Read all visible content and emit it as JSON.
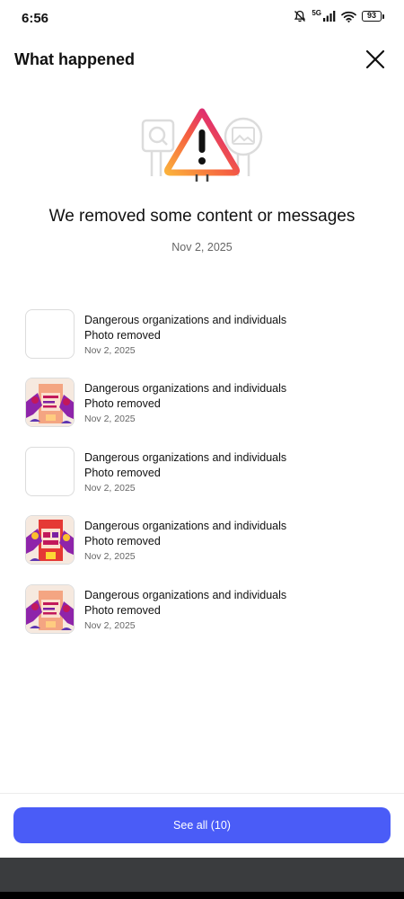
{
  "status_bar": {
    "time": "6:56",
    "network": "5G",
    "battery": "93",
    "icons": [
      "bell-muted-icon",
      "signal-icon",
      "wifi-icon",
      "battery-icon"
    ]
  },
  "header": {
    "title": "What happened",
    "close_icon": "close-icon"
  },
  "hero": {
    "icon": "warning-icon",
    "title": "We removed some content or messages",
    "date": "Nov 2, 2025"
  },
  "items": [
    {
      "reason": "Dangerous organizations and individuals",
      "status": "Photo removed",
      "date": "Nov 2, 2025",
      "thumb": "blank"
    },
    {
      "reason": "Dangerous organizations and individuals",
      "status": "Photo removed",
      "date": "Nov 2, 2025",
      "thumb": "illustration"
    },
    {
      "reason": "Dangerous organizations and individuals",
      "status": "Photo removed",
      "date": "Nov 2, 2025",
      "thumb": "blank"
    },
    {
      "reason": "Dangerous organizations and individuals",
      "status": "Photo removed",
      "date": "Nov 2, 2025",
      "thumb": "illustration"
    },
    {
      "reason": "Dangerous organizations and individuals",
      "status": "Photo removed",
      "date": "Nov 2, 2025",
      "thumb": "illustration"
    }
  ],
  "footer": {
    "see_all_label": "See all (10)"
  },
  "colors": {
    "primary_button": "#4a5cf7",
    "nav_bar": "#3a3c3e",
    "warning_gradient_start": "#fbb03b",
    "warning_gradient_mid": "#e4405f",
    "warning_gradient_end": "#833ab4"
  }
}
